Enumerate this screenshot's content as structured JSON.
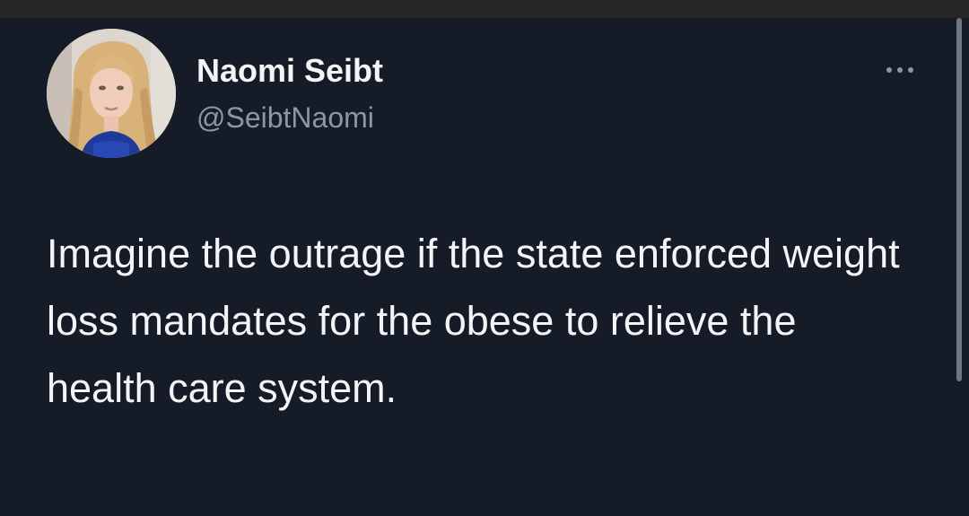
{
  "tweet": {
    "author": {
      "display_name": "Naomi Seibt",
      "handle": "@SeibtNaomi"
    },
    "text": "Imagine the outrage if the state enforced weight loss mandates for the obese to relieve the health care system.",
    "more_icon": "more-horizontal-icon"
  },
  "colors": {
    "background": "#151c28",
    "text_primary": "#f2f4f6",
    "text_secondary": "#8a97a6"
  }
}
